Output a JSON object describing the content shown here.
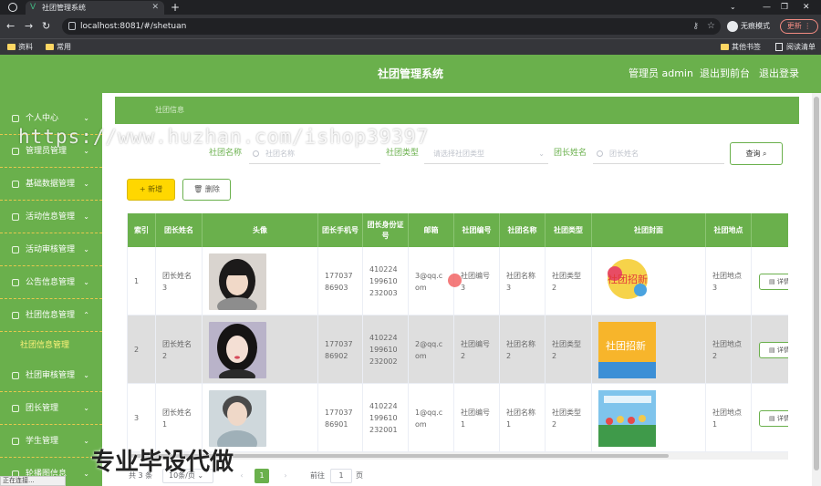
{
  "browser": {
    "tab_title": "社团管理系统",
    "url": "localhost:8081/#/shetuan",
    "incognito_label": "无痕模式",
    "update_label": "更新",
    "bookmarks": [
      "资料",
      "常用"
    ],
    "bookmarks_right": [
      "其他书签",
      "阅读清单"
    ]
  },
  "header": {
    "title": "社团管理系统",
    "admin": "管理员 admin",
    "to_front": "退出到前台",
    "logout": "退出登录"
  },
  "sidebar": {
    "items": [
      {
        "label": "个人中心"
      },
      {
        "label": "管理员管理"
      },
      {
        "label": "基础数据管理"
      },
      {
        "label": "活动信息管理"
      },
      {
        "label": "活动审核管理"
      },
      {
        "label": "公告信息管理"
      },
      {
        "label": "社团信息管理"
      },
      {
        "label": "社团审核管理"
      },
      {
        "label": "团长管理"
      },
      {
        "label": "学生管理"
      },
      {
        "label": "轮播图信息"
      }
    ],
    "active_sub": "社团信息管理"
  },
  "breadcrumb": "社团信息",
  "search": {
    "name_label": "社团名称",
    "name_placeholder": "社团名称",
    "type_label": "社团类型",
    "type_placeholder": "请选择社团类型",
    "leader_label": "团长姓名",
    "leader_placeholder": "团长姓名",
    "query_label": "查询"
  },
  "actions": {
    "add_label": "新增",
    "delete_label": "删除"
  },
  "table": {
    "headers": [
      "索引",
      "团长姓名",
      "头像",
      "团长手机号",
      "团长身份证号",
      "邮箱",
      "社团编号",
      "社团名称",
      "社团类型",
      "社团封面",
      "社团地点"
    ],
    "detail_label": "详情",
    "rows": [
      {
        "index": "1",
        "leader": "团长姓名3",
        "phone": "17703786903",
        "idcard": "410224199610232003",
        "email": "3@qq.com",
        "code": "社团编号3",
        "name": "社团名称3",
        "type": "社团类型2",
        "place": "社团地点3",
        "cover_text": "社团招新"
      },
      {
        "index": "2",
        "leader": "团长姓名2",
        "phone": "17703786902",
        "idcard": "410224199610232002",
        "email": "2@qq.com",
        "code": "社团编号2",
        "name": "社团名称2",
        "type": "社团类型2",
        "place": "社团地点2",
        "cover_text": "社团招新"
      },
      {
        "index": "3",
        "leader": "团长姓名1",
        "phone": "17703786901",
        "idcard": "410224199610232001",
        "email": "1@qq.com",
        "code": "社团编号1",
        "name": "社团名称1",
        "type": "社团类型2",
        "place": "社团地点1",
        "cover_text": ""
      }
    ]
  },
  "pagination": {
    "total": "共 3 条",
    "page_size": "10条/页",
    "current_page": "1",
    "goto_label": "前往",
    "goto_value": "1",
    "page_unit": "页"
  },
  "status_text": "正在连接...",
  "watermark": "https://www.huzhan.com/ishop39397",
  "watermark2": "专业毕设代做",
  "colors": {
    "primary": "#6ab04c",
    "accent": "#ffd700",
    "menu_active": "#fff37a"
  }
}
